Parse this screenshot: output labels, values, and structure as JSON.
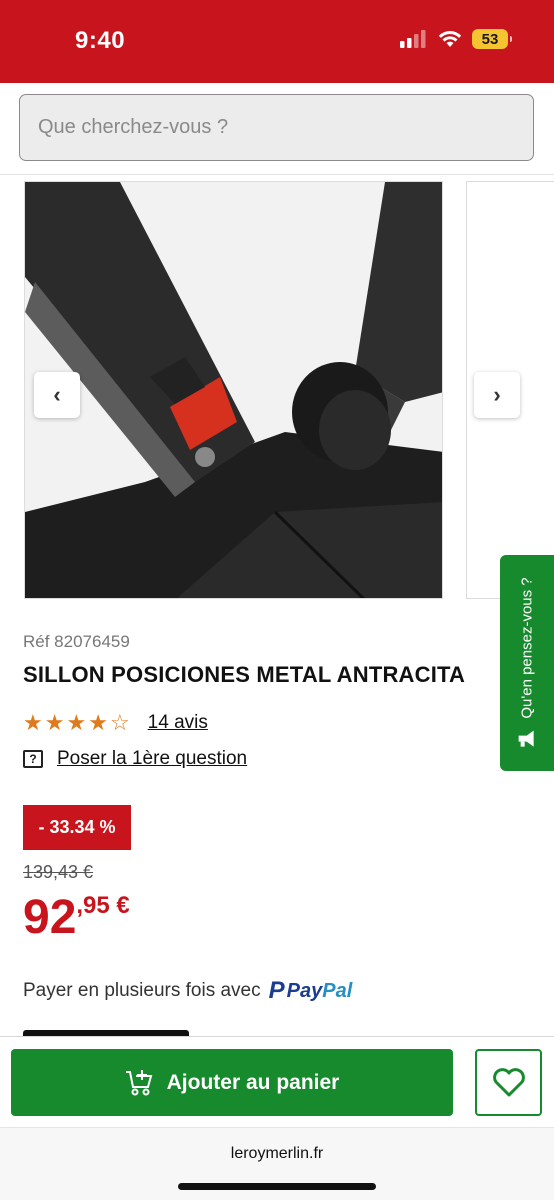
{
  "status": {
    "time": "9:40",
    "battery": "53"
  },
  "search": {
    "placeholder": "Que cherchez-vous ?"
  },
  "gallery": {
    "prev_label": "‹",
    "next_label": "›"
  },
  "product": {
    "ref": "Réf 82076459",
    "title": "SILLON POSICIONES METAL ANTRACITA",
    "rating": 4,
    "rating_max": 5,
    "reviews_label": "14 avis",
    "question_label": "Poser la 1ère question"
  },
  "pricing": {
    "discount": "- 33.34 %",
    "old_price": "139,43 €",
    "price_int": "92",
    "price_dec": ",95 €"
  },
  "payment": {
    "text": "Payer en plusieurs fois avec",
    "paypal_pay": "Pay",
    "paypal_pal": "Pal"
  },
  "actions": {
    "add_to_cart": "Ajouter au panier"
  },
  "feedback": {
    "label": "Qu'en pensez-vous ?"
  },
  "browser": {
    "url": "leroymerlin.fr"
  },
  "colors": {
    "brand_red": "#c8141c",
    "brand_green": "#188a2e",
    "star": "#e07b1c"
  }
}
